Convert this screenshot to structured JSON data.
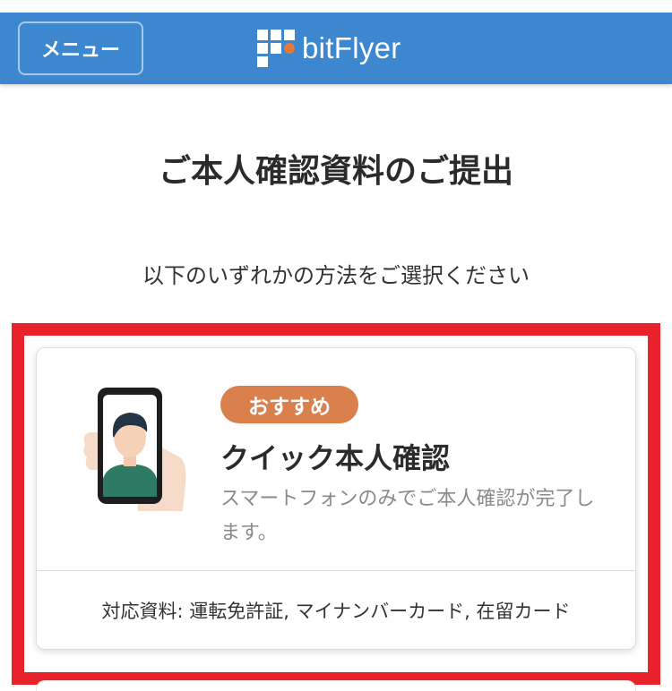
{
  "header": {
    "menu_label": "メニュー",
    "logo_text": "bitFlyer",
    "background_color": "#3d87cf",
    "accent_color": "#e07a3f"
  },
  "main": {
    "title": "ご本人確認資料のご提出",
    "instructions": "以下のいずれかの方法をご選択ください"
  },
  "options": [
    {
      "badge": "おすすめ",
      "title": "クイック本人確認",
      "description": "スマートフォンのみでご本人確認が完了します。",
      "footer": "対応資料: 運転免許証, マイナンバーカード, 在留カード",
      "icon": "smartphone-selfie-icon"
    }
  ],
  "highlight_color": "#e8212b"
}
